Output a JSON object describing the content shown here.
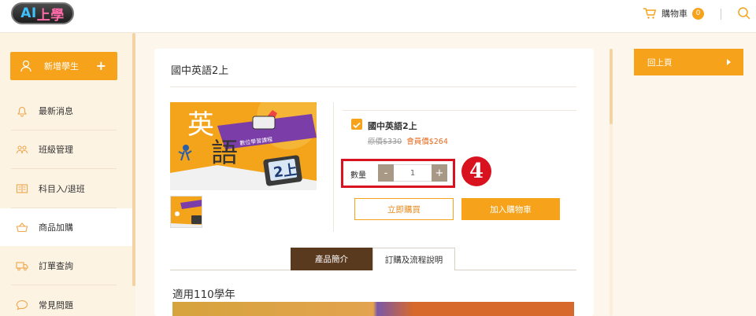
{
  "header": {
    "logo_ai": "AI",
    "logo_school": "上學",
    "cart_label": "購物車",
    "cart_count": "0"
  },
  "sidebar": {
    "add_student_label": "新增學生",
    "add_student_plus": "+",
    "items": [
      {
        "label": "最新消息",
        "icon": "bell-icon"
      },
      {
        "label": "班級管理",
        "icon": "users-icon"
      },
      {
        "label": "科目入/退班",
        "icon": "book-open-icon"
      },
      {
        "label": "商品加購",
        "icon": "basket-icon",
        "active": true
      },
      {
        "label": "訂單查詢",
        "icon": "truck-icon"
      },
      {
        "label": "常見問題",
        "icon": "chat-bubble-icon"
      }
    ]
  },
  "product": {
    "title": "國中英語2上",
    "option_name": "國中英語2上",
    "original_price_label": "原價",
    "original_price": "$330",
    "member_price_label": "會員價",
    "member_price": "$264",
    "quantity_label": "數量",
    "quantity_value": "1",
    "minus_label": "-",
    "plus_label": "+",
    "step_marker": "4",
    "buy_now_label": "立即購買",
    "add_to_cart_label": "加入購物車",
    "image_texts": {
      "big_char_1": "英",
      "big_char_2": "語",
      "ribbon": "數位學習課程",
      "grade": "2上"
    }
  },
  "tabs": [
    {
      "label": "產品簡介",
      "active": true
    },
    {
      "label": "訂購及流程說明",
      "active": false
    }
  ],
  "description": {
    "applicable": "適用110學年"
  },
  "right_panel": {
    "back_label": "回上頁"
  },
  "colors": {
    "accent": "#f6a21a",
    "background": "#fdf6ec",
    "tab_active": "#5a3a1f",
    "highlight": "#d9121f",
    "member_price": "#e66a1f"
  }
}
